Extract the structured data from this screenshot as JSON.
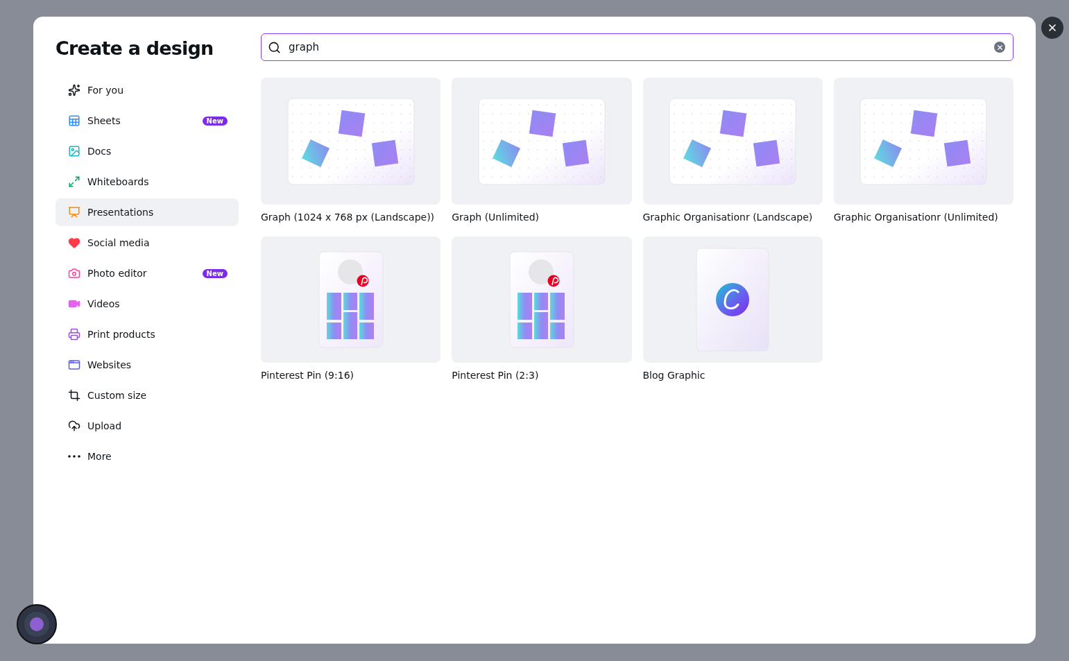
{
  "dialog": {
    "title": "Create a design"
  },
  "sidebar": {
    "items": [
      {
        "label": "For you",
        "selected": false
      },
      {
        "label": "Sheets",
        "selected": false,
        "badge": "New"
      },
      {
        "label": "Docs",
        "selected": false
      },
      {
        "label": "Whiteboards",
        "selected": false
      },
      {
        "label": "Presentations",
        "selected": true
      },
      {
        "label": "Social media",
        "selected": false
      },
      {
        "label": "Photo editor",
        "selected": false,
        "badge": "New"
      },
      {
        "label": "Videos",
        "selected": false
      },
      {
        "label": "Print products",
        "selected": false
      },
      {
        "label": "Websites",
        "selected": false
      },
      {
        "label": "Custom size",
        "selected": false
      },
      {
        "label": "Upload",
        "selected": false
      },
      {
        "label": "More",
        "selected": false
      }
    ]
  },
  "search": {
    "value": "graph"
  },
  "results": [
    {
      "title": "Graph (1024 x 768 px (Landscape))",
      "kind": "landscape"
    },
    {
      "title": "Graph (Unlimited)",
      "kind": "landscape"
    },
    {
      "title": "Graphic Organisationr (Landscape)",
      "kind": "landscape"
    },
    {
      "title": "Graphic Organisationr (Unlimited)",
      "kind": "landscape"
    },
    {
      "title": "Pinterest Pin (9:16)",
      "kind": "pin"
    },
    {
      "title": "Pinterest Pin (2:3)",
      "kind": "pin"
    },
    {
      "title": "Blog Graphic",
      "kind": "blog"
    }
  ]
}
